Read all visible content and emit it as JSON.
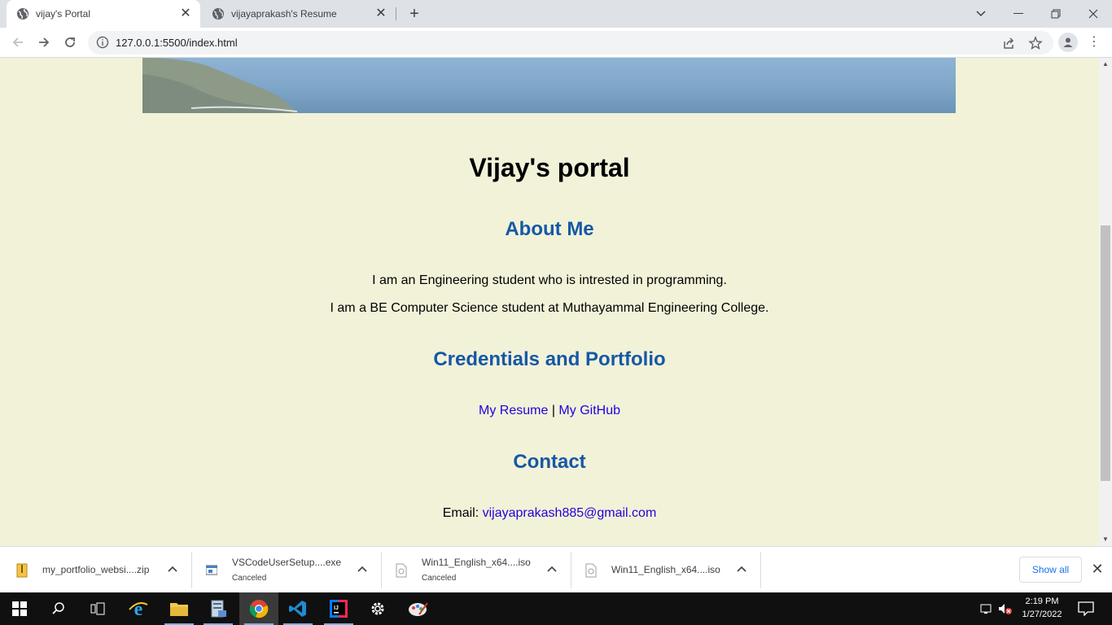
{
  "browser": {
    "tabs": [
      {
        "title": "vijay's Portal",
        "active": true
      },
      {
        "title": "vijayaprakash's Resume",
        "active": false
      }
    ],
    "url": "127.0.0.1:5500/index.html"
  },
  "page": {
    "title": "Vijay's portal",
    "about": {
      "heading": "About Me",
      "line1": "I am an Engineering student who is intrested in programming.",
      "line2": "I am a BE Computer Science student at Muthayammal Engineering College."
    },
    "credentials": {
      "heading": "Credentials and Portfolio",
      "resume_link": "My Resume",
      "separator": "|",
      "github_link": "My GitHub"
    },
    "contact": {
      "heading": "Contact",
      "email_label": "Email:",
      "email": "vijayaprakash885@gmail.com"
    }
  },
  "downloads": {
    "items": [
      {
        "name": "my_portfolio_websi....zip",
        "status": "",
        "icon": "zip-file-icon"
      },
      {
        "name": "VSCodeUserSetup....exe",
        "status": "Canceled",
        "icon": "exe-file-icon"
      },
      {
        "name": "Win11_English_x64....iso",
        "status": "Canceled",
        "icon": "iso-file-icon"
      },
      {
        "name": "Win11_English_x64....iso",
        "status": "",
        "icon": "iso-file-icon"
      }
    ],
    "show_all": "Show all"
  },
  "taskbar": {
    "time": "2:19 PM",
    "date": "1/27/2022",
    "apps": [
      "windows-start-icon",
      "search-icon",
      "task-view-icon",
      "internet-explorer-icon",
      "file-explorer-icon",
      "server-manager-icon",
      "chrome-icon",
      "vscode-icon",
      "intellij-icon",
      "settings-gear-icon",
      "paint-icon"
    ]
  },
  "colors": {
    "page_bg": "#f2f2d9",
    "heading": "#1558a6",
    "link": "#2200dd"
  }
}
